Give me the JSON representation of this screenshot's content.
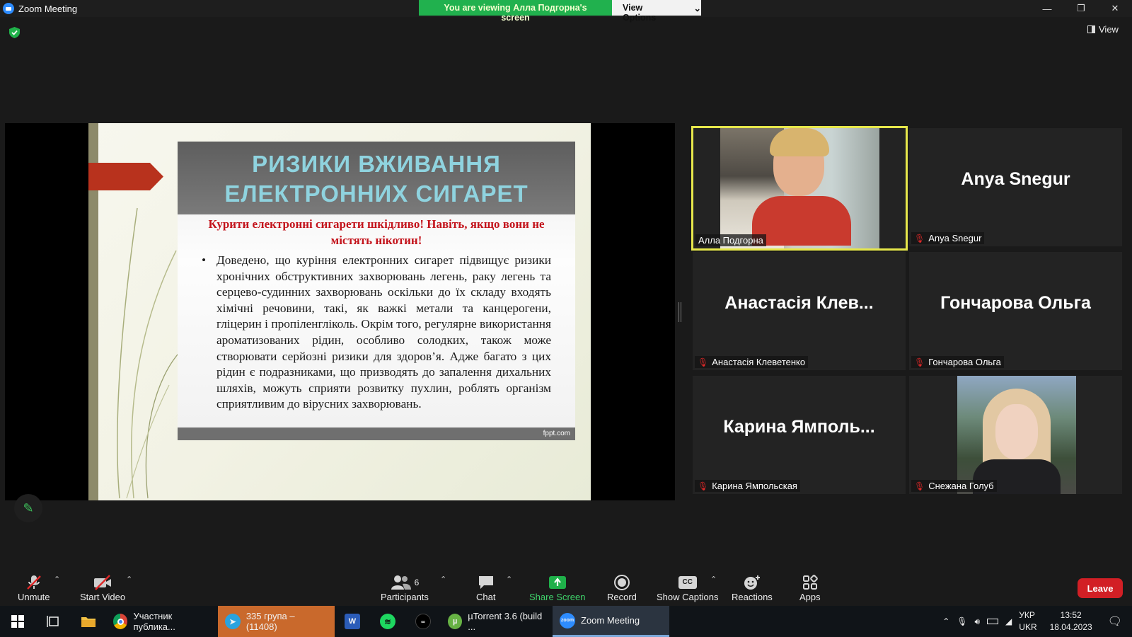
{
  "window": {
    "title": "Zoom Meeting"
  },
  "banner": {
    "text": "You are viewing Алла Подгорна's screen",
    "button": "View Options"
  },
  "view_button": "View",
  "slide": {
    "title_line1": "РИЗИКИ ВЖИВАННЯ",
    "title_line2": "ЕЛЕКТРОННИХ СИГАРЕТ",
    "warning": "Курити електронні сигарети шкідливо! Навіть, якщо вони не містять нікотин!",
    "bullet": "Доведено, що куріння електронних сигарет підвищує ризики хронічних обструктивних захворювань легень, раку легень та серцево-судинних захворювань оскільки до їх складу входять хімічні речовини, такі, як важкі метали та канцерогени, гліцерин і пропіленгліколь. Окрім того, регулярне використання ароматизованих рідин, особливо солодких, також може створювати серйозні ризики для здоров’я. Адже багато з цих рідин є подразниками, що призводять до запалення дихальних шляхів, можуть сприяти розвитку пухлин, роблять організм сприятливим до вірусних захворювань.",
    "footer": "fppt.com"
  },
  "participants": [
    {
      "display": "",
      "label": "Алла Подгорна",
      "muted": false
    },
    {
      "display": "Anya Snegur",
      "label": "Anya Snegur",
      "muted": true
    },
    {
      "display": "Анастасія Клев...",
      "label": "Анастасія Клеветенко",
      "muted": true
    },
    {
      "display": "Гончарова Ольга",
      "label": "Гончарова Ольга",
      "muted": true
    },
    {
      "display": "Карина Ямполь...",
      "label": "Карина Ямпольская",
      "muted": true
    },
    {
      "display": "",
      "label": "Снежана Голуб",
      "muted": true
    }
  ],
  "toolbar": {
    "unmute": "Unmute",
    "start_video": "Start Video",
    "participants": "Participants",
    "participants_count": "6",
    "chat": "Chat",
    "share_screen": "Share Screen",
    "record": "Record",
    "show_captions": "Show Captions",
    "reactions": "Reactions",
    "apps": "Apps",
    "leave": "Leave"
  },
  "taskbar": {
    "chrome": "Участник публика...",
    "telegram": "335 група – (11408)",
    "utorrent": "µTorrent 3.6  (build ...",
    "zoom": "Zoom Meeting",
    "lang_top": "УКР",
    "lang_bottom": "UKR",
    "time": "13:52",
    "date": "18.04.2023"
  },
  "colors": {
    "banner_green": "#21b14e",
    "active_speaker": "#e6e74b",
    "leave_red": "#d21f25",
    "share_green": "#3fd16a"
  }
}
